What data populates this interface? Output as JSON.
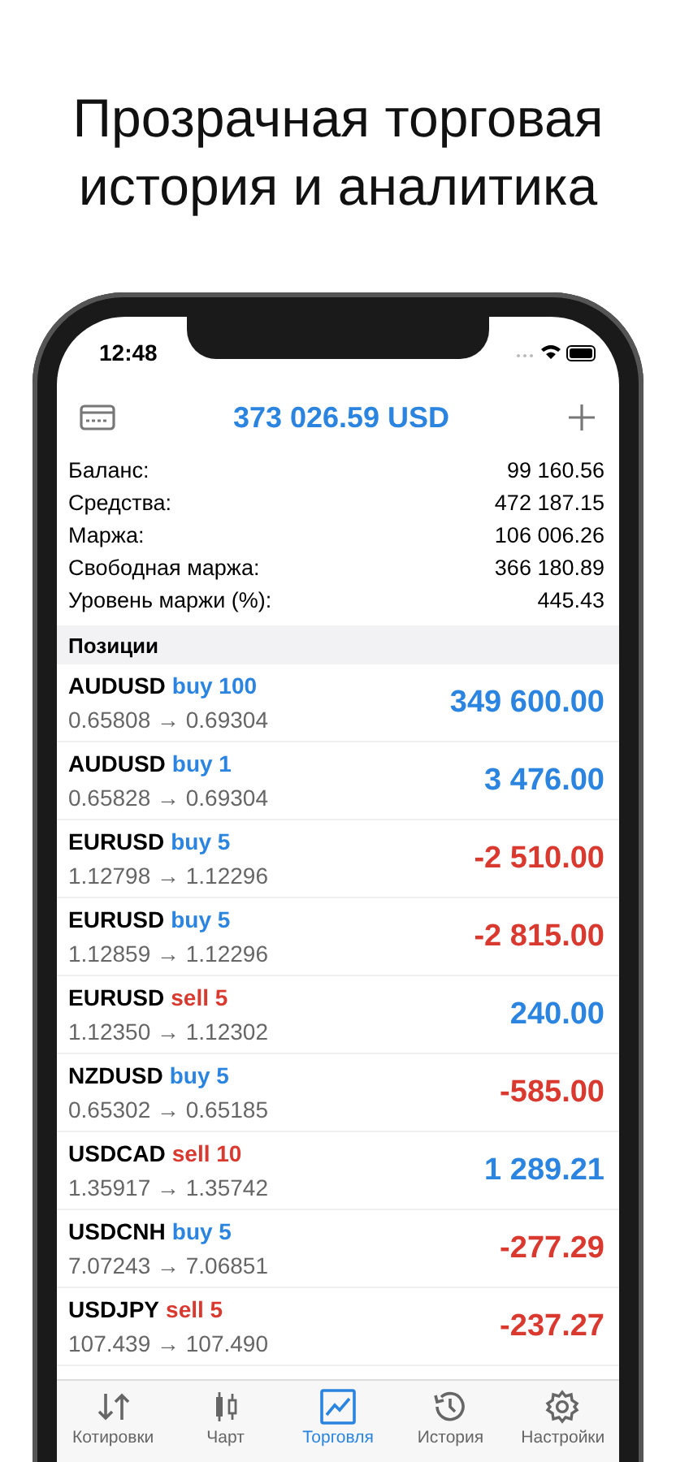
{
  "headline": "Прозрачная торговая история и аналитика",
  "status_bar": {
    "time": "12:48"
  },
  "header": {
    "total": "373 026.59 USD"
  },
  "summary": [
    {
      "label": "Баланс:",
      "value": "99 160.56"
    },
    {
      "label": "Средства:",
      "value": "472 187.15"
    },
    {
      "label": "Маржа:",
      "value": "106 006.26"
    },
    {
      "label": "Свободная маржа:",
      "value": "366 180.89"
    },
    {
      "label": "Уровень маржи (%):",
      "value": "445.43"
    }
  ],
  "section_title": "Позиции",
  "positions": [
    {
      "symbol": "AUDUSD",
      "kind": "buy",
      "side": "buy 100",
      "prices": "0.65808 → 0.69304",
      "profit": "349 600.00",
      "color": "#2a84e0"
    },
    {
      "symbol": "AUDUSD",
      "kind": "buy",
      "side": "buy 1",
      "prices": "0.65828 → 0.69304",
      "profit": "3 476.00",
      "color": "#2a84e0"
    },
    {
      "symbol": "EURUSD",
      "kind": "buy",
      "side": "buy 5",
      "prices": "1.12798 → 1.12296",
      "profit": "-2 510.00",
      "color": "#d9392f"
    },
    {
      "symbol": "EURUSD",
      "kind": "buy",
      "side": "buy 5",
      "prices": "1.12859 → 1.12296",
      "profit": "-2 815.00",
      "color": "#d9392f"
    },
    {
      "symbol": "EURUSD",
      "kind": "sell",
      "side": "sell 5",
      "prices": "1.12350 → 1.12302",
      "profit": "240.00",
      "color": "#2a84e0"
    },
    {
      "symbol": "NZDUSD",
      "kind": "buy",
      "side": "buy 5",
      "prices": "0.65302 → 0.65185",
      "profit": "-585.00",
      "color": "#d9392f"
    },
    {
      "symbol": "USDCAD",
      "kind": "sell",
      "side": "sell 10",
      "prices": "1.35917 → 1.35742",
      "profit": "1 289.21",
      "color": "#2a84e0"
    },
    {
      "symbol": "USDCNH",
      "kind": "buy",
      "side": "buy 5",
      "prices": "7.07243 → 7.06851",
      "profit": "-277.29",
      "color": "#d9392f"
    },
    {
      "symbol": "USDJPY",
      "kind": "sell",
      "side": "sell 5",
      "prices": "107.439 → 107.490",
      "profit": "-237.27",
      "color": "#d9392f"
    }
  ],
  "tabs": [
    {
      "label": "Котировки",
      "kind": "quotes",
      "selected": false
    },
    {
      "label": "Чарт",
      "kind": "chart",
      "selected": false
    },
    {
      "label": "Торговля",
      "kind": "trade",
      "selected": true
    },
    {
      "label": "История",
      "kind": "history",
      "selected": false
    },
    {
      "label": "Настройки",
      "kind": "settings",
      "selected": false
    }
  ]
}
